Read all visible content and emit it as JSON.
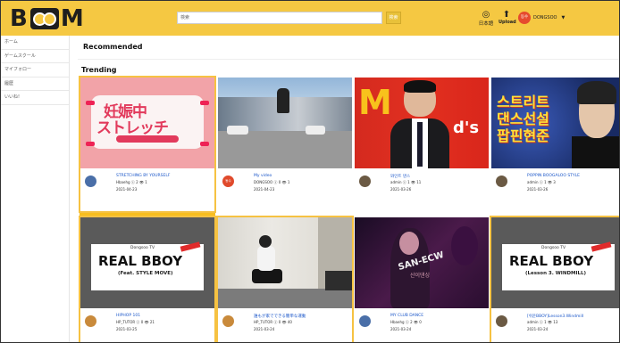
{
  "header": {
    "logo_letters": [
      "B",
      "M"
    ],
    "search_value": "検索",
    "search_button": "検索",
    "lang_label": "日本語",
    "upload_label": "Upload",
    "user_avatar": "동수",
    "user_name": "DONGSOO"
  },
  "sidebar": {
    "items": [
      {
        "label": "ホーム"
      },
      {
        "label": "ゲームスクール"
      },
      {
        "label": "マイフォロー"
      },
      {
        "label": "履歴"
      },
      {
        "label": "いいね!"
      }
    ]
  },
  "main": {
    "title": "Recommended",
    "section": "Trending"
  },
  "videos": [
    {
      "title": "STRETCHING BY YOURSELF",
      "stats": "Hbaehg ⓢ 2 👁 1",
      "date": "2021-04-23",
      "avatar_color": "#4a6fa8",
      "thumb_text_1": "妊娠中",
      "thumb_text_2": "ストレッチ"
    },
    {
      "title": "My video",
      "stats": "DONGSOO ⓢ 0 👁 1",
      "date": "2021-04-23",
      "avatar_color": "#e04a2c",
      "avatar_text": "동수"
    },
    {
      "title": "와인트 댄스",
      "stats": "admin ⓢ 1 👁 11",
      "date": "2021-03-26",
      "avatar_color": "#6b5a44",
      "thumb_text_1": "d's"
    },
    {
      "title": "POPPIN BOOGALOO STYLE",
      "stats": "admin ⓢ 1 👁 3",
      "date": "2021-03-26",
      "avatar_color": "#6b5a44",
      "thumb_text_1": "스트리트",
      "thumb_text_2": "댄스선설",
      "thumb_text_3": "팝핀현준"
    },
    {
      "title": "HIPHOP 101",
      "stats": "HP_TUTOR ⓢ 0 👁 21",
      "date": "2021-03-25",
      "avatar_color": "#c98a3b",
      "thumb_text_1": "REAL BBOY",
      "thumb_text_2": "(Feat. STYLE MOVE)",
      "thumb_text_3": "Dongsoo TV"
    },
    {
      "title": "誰もが家でできる簡単な運動",
      "stats": "HP_TUTOR ⓢ 0 👁 40",
      "date": "2021-03-24",
      "avatar_color": "#c98a3b"
    },
    {
      "title": "MY CLUB DANCE",
      "stats": "Hbaehg ⓢ 2 👁 0",
      "date": "2021-03-24",
      "avatar_color": "#4a6fa8",
      "thumb_text_1": "SAN-ECW",
      "thumb_text_2": "산이댄싱"
    },
    {
      "title": "[쉬운BBOY]Lesson3.Windmill",
      "stats": "admin ⓢ 1 👁 13",
      "date": "2021-03-24",
      "avatar_color": "#6b5a44",
      "thumb_text_1": "REAL BBOY",
      "thumb_text_2": "(Lesson 3. WINDMILL)",
      "thumb_text_3": "Dongsoo TV"
    }
  ],
  "colors": {
    "header": "#f5c842",
    "highlight": "#f6c242",
    "link": "#1a56c9"
  }
}
